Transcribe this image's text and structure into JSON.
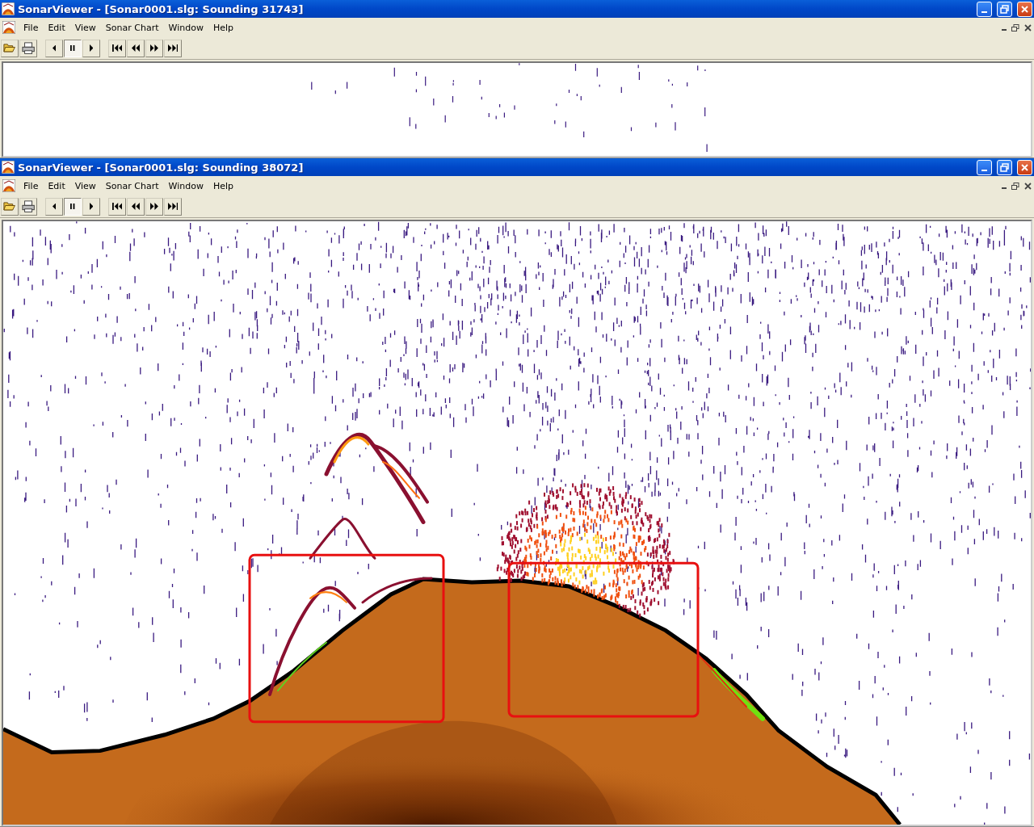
{
  "windows": [
    {
      "title": "SonarViewer - [Sonar0001.slg: Sounding 31743]",
      "menu": [
        "File",
        "Edit",
        "View",
        "Sonar Chart",
        "Window",
        "Help"
      ],
      "toolbar": [
        {
          "buttons": [
            {
              "kind": "open",
              "selected": false
            },
            {
              "kind": "print",
              "selected": false
            }
          ]
        },
        {
          "buttons": [
            {
              "kind": "step-back",
              "selected": false
            },
            {
              "kind": "pause",
              "selected": true
            },
            {
              "kind": "step-forward",
              "selected": false
            }
          ]
        },
        {
          "buttons": [
            {
              "kind": "first",
              "selected": false
            },
            {
              "kind": "rewind",
              "selected": false
            },
            {
              "kind": "fast-forward",
              "selected": false
            },
            {
              "kind": "last",
              "selected": false
            }
          ]
        }
      ],
      "view": {
        "kind": "sparse"
      }
    },
    {
      "title": "SonarViewer - [Sonar0001.slg: Sounding 38072]",
      "menu": [
        "File",
        "Edit",
        "View",
        "Sonar Chart",
        "Window",
        "Help"
      ],
      "toolbar": [
        {
          "buttons": [
            {
              "kind": "open",
              "selected": false
            },
            {
              "kind": "print",
              "selected": false
            }
          ]
        },
        {
          "buttons": [
            {
              "kind": "step-back",
              "selected": false
            },
            {
              "kind": "pause",
              "selected": true
            },
            {
              "kind": "step-forward",
              "selected": false
            }
          ]
        },
        {
          "buttons": [
            {
              "kind": "first",
              "selected": false
            },
            {
              "kind": "rewind",
              "selected": false
            },
            {
              "kind": "fast-forward",
              "selected": false
            },
            {
              "kind": "last",
              "selected": false
            }
          ]
        }
      ],
      "view": {
        "kind": "full"
      }
    }
  ]
}
